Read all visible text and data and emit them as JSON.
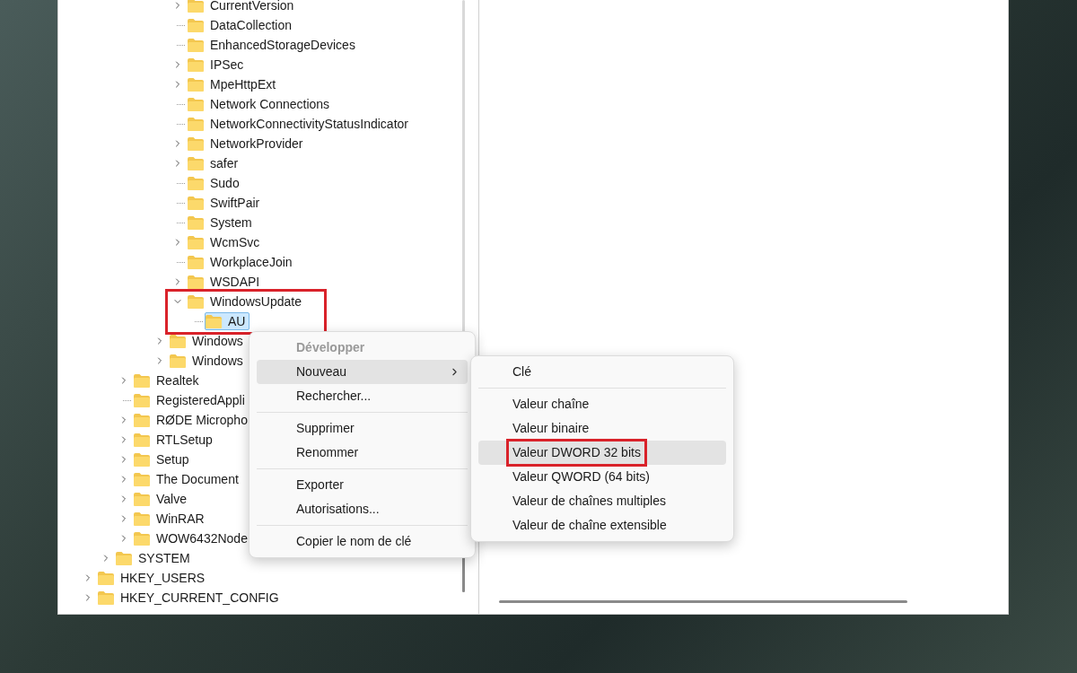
{
  "tree": {
    "items": [
      {
        "children": [
          {
            "children": [
              {
                "children": [
                  {
                    "children": [
                      {
                        "children": [
                          {
                            "label": "CurrentVersion",
                            "kind": "collapsed",
                            "selected": false
                          },
                          {
                            "label": "DataCollection",
                            "kind": "leaf",
                            "selected": false
                          },
                          {
                            "label": "EnhancedStorageDevices",
                            "kind": "leaf",
                            "selected": false
                          },
                          {
                            "label": "IPSec",
                            "kind": "collapsed",
                            "selected": false
                          },
                          {
                            "label": "MpeHttpExt",
                            "kind": "collapsed",
                            "selected": false
                          },
                          {
                            "label": "Network Connections",
                            "kind": "leaf",
                            "selected": false
                          },
                          {
                            "label": "NetworkConnectivityStatusIndicator",
                            "kind": "leaf",
                            "selected": false
                          },
                          {
                            "label": "NetworkProvider",
                            "kind": "collapsed",
                            "selected": false
                          },
                          {
                            "label": "safer",
                            "kind": "collapsed",
                            "selected": false
                          },
                          {
                            "label": "Sudo",
                            "kind": "leaf",
                            "selected": false
                          },
                          {
                            "label": "SwiftPair",
                            "kind": "leaf",
                            "selected": false
                          },
                          {
                            "label": "System",
                            "kind": "leaf",
                            "selected": false
                          },
                          {
                            "label": "WcmSvc",
                            "kind": "collapsed",
                            "selected": false
                          },
                          {
                            "label": "WorkplaceJoin",
                            "kind": "leaf",
                            "selected": false
                          },
                          {
                            "label": "WSDAPI",
                            "kind": "collapsed",
                            "selected": false
                          },
                          {
                            "label": "WindowsUpdate",
                            "kind": "expanded",
                            "selected": false,
                            "highlighted": true,
                            "children": [
                              {
                                "label": "AU",
                                "kind": "leaf",
                                "selected": true
                              }
                            ]
                          }
                        ]
                      },
                      {
                        "label": "Windows",
                        "kind": "collapsed",
                        "selected": false
                      },
                      {
                        "label": "Windows",
                        "kind": "collapsed",
                        "selected": false
                      }
                    ]
                  }
                ]
              },
              {
                "label": "Realtek",
                "kind": "collapsed",
                "selected": false
              },
              {
                "label": "RegisteredAppli",
                "kind": "leaf",
                "selected": false
              },
              {
                "label": "RØDE Micropho",
                "kind": "collapsed",
                "selected": false
              },
              {
                "label": "RTLSetup",
                "kind": "collapsed",
                "selected": false
              },
              {
                "label": "Setup",
                "kind": "collapsed",
                "selected": false
              },
              {
                "label": "The Document",
                "kind": "collapsed",
                "selected": false
              },
              {
                "label": "Valve",
                "kind": "collapsed",
                "selected": false
              },
              {
                "label": "WinRAR",
                "kind": "collapsed",
                "selected": false
              },
              {
                "label": "WOW6432Node",
                "kind": "collapsed",
                "selected": false
              }
            ]
          },
          {
            "label": "SYSTEM",
            "kind": "collapsed",
            "selected": false
          }
        ]
      },
      {
        "label": "HKEY_USERS",
        "kind": "collapsed",
        "selected": false
      },
      {
        "label": "HKEY_CURRENT_CONFIG",
        "kind": "collapsed",
        "selected": false
      }
    ]
  },
  "context_menu": {
    "items": [
      {
        "kind": "item",
        "label": "Développer",
        "disabled": true,
        "hovered": false
      },
      {
        "kind": "submenu",
        "label": "Nouveau",
        "disabled": false,
        "hovered": true
      },
      {
        "kind": "item",
        "label": "Rechercher...",
        "disabled": false,
        "hovered": false
      },
      {
        "kind": "separator"
      },
      {
        "kind": "item",
        "label": "Supprimer",
        "disabled": false,
        "hovered": false
      },
      {
        "kind": "item",
        "label": "Renommer",
        "disabled": false,
        "hovered": false
      },
      {
        "kind": "separator"
      },
      {
        "kind": "item",
        "label": "Exporter",
        "disabled": false,
        "hovered": false
      },
      {
        "kind": "item",
        "label": "Autorisations...",
        "disabled": false,
        "hovered": false
      },
      {
        "kind": "separator"
      },
      {
        "kind": "item",
        "label": "Copier le nom de clé",
        "disabled": false,
        "hovered": false
      }
    ]
  },
  "submenu": {
    "items": [
      {
        "kind": "item",
        "label": "Clé",
        "hovered": false,
        "highlighted": false
      },
      {
        "kind": "separator"
      },
      {
        "kind": "item",
        "label": "Valeur chaîne",
        "hovered": false,
        "highlighted": false
      },
      {
        "kind": "item",
        "label": "Valeur binaire",
        "hovered": false,
        "highlighted": false
      },
      {
        "kind": "item",
        "label": "Valeur DWORD 32 bits",
        "hovered": true,
        "highlighted": true
      },
      {
        "kind": "item",
        "label": "Valeur QWORD (64 bits)",
        "hovered": false,
        "highlighted": false
      },
      {
        "kind": "item",
        "label": "Valeur de chaînes multiples",
        "hovered": false,
        "highlighted": false
      },
      {
        "kind": "item",
        "label": "Valeur de chaîne extensible",
        "hovered": false,
        "highlighted": false
      }
    ]
  }
}
